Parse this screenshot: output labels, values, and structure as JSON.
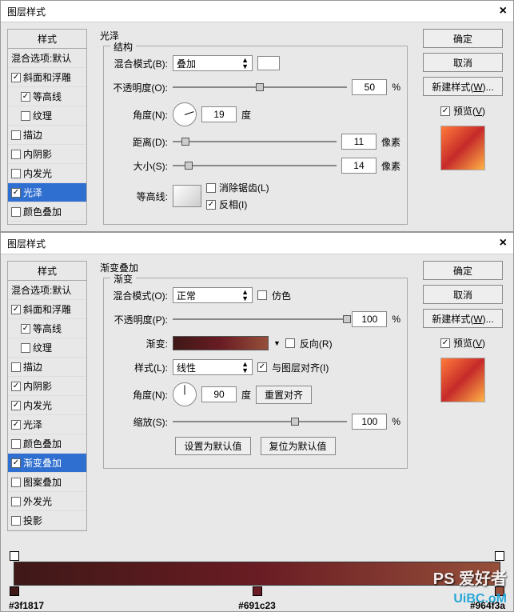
{
  "dialog1": {
    "title": "图层样式",
    "styles_header": "样式",
    "blend_options": "混合选项:默认",
    "items": [
      {
        "label": "斜面和浮雕",
        "checked": true,
        "indent": false
      },
      {
        "label": "等高线",
        "checked": true,
        "indent": true
      },
      {
        "label": "纹理",
        "checked": false,
        "indent": true
      },
      {
        "label": "描边",
        "checked": false,
        "indent": false
      },
      {
        "label": "内阴影",
        "checked": false,
        "indent": false
      },
      {
        "label": "内发光",
        "checked": false,
        "indent": false
      },
      {
        "label": "光泽",
        "checked": true,
        "indent": false,
        "selected": true
      },
      {
        "label": "颜色叠加",
        "checked": false,
        "indent": false
      }
    ],
    "section_title": "光泽",
    "group_title": "结构",
    "rows": {
      "blend_mode_label": "混合模式(B):",
      "blend_mode_value": "叠加",
      "opacity_label": "不透明度(O):",
      "opacity_value": "50",
      "opacity_unit": "%",
      "angle_label": "角度(N):",
      "angle_value": "19",
      "angle_unit": "度",
      "distance_label": "距离(D):",
      "distance_value": "11",
      "distance_unit": "像素",
      "size_label": "大小(S):",
      "size_value": "14",
      "size_unit": "像素",
      "contour_label": "等高线:",
      "antialias_label": "消除锯齿(L)",
      "invert_label": "反相(I)"
    },
    "buttons": {
      "ok": "确定",
      "cancel": "取消",
      "new_style": "新建样式(W)...",
      "preview": "预览(V)"
    }
  },
  "dialog2": {
    "title": "图层样式",
    "styles_header": "样式",
    "blend_options": "混合选项:默认",
    "items": [
      {
        "label": "斜面和浮雕",
        "checked": true,
        "indent": false
      },
      {
        "label": "等高线",
        "checked": true,
        "indent": true
      },
      {
        "label": "纹理",
        "checked": false,
        "indent": true
      },
      {
        "label": "描边",
        "checked": false,
        "indent": false
      },
      {
        "label": "内阴影",
        "checked": true,
        "indent": false
      },
      {
        "label": "内发光",
        "checked": true,
        "indent": false
      },
      {
        "label": "光泽",
        "checked": true,
        "indent": false
      },
      {
        "label": "颜色叠加",
        "checked": false,
        "indent": false
      },
      {
        "label": "渐变叠加",
        "checked": true,
        "indent": false,
        "selected": true
      },
      {
        "label": "图案叠加",
        "checked": false,
        "indent": false
      },
      {
        "label": "外发光",
        "checked": false,
        "indent": false
      },
      {
        "label": "投影",
        "checked": false,
        "indent": false
      }
    ],
    "section_title": "渐变叠加",
    "group_title": "渐变",
    "rows": {
      "blend_mode_label": "混合模式(O):",
      "blend_mode_value": "正常",
      "dither_label": "仿色",
      "opacity_label": "不透明度(P):",
      "opacity_value": "100",
      "opacity_unit": "%",
      "gradient_label": "渐变:",
      "reverse_label": "反向(R)",
      "style_label": "样式(L):",
      "style_value": "线性",
      "align_label": "与图层对齐(I)",
      "angle_label": "角度(N):",
      "angle_value": "90",
      "angle_unit": "度",
      "reset_align": "重置对齐",
      "scale_label": "缩放(S):",
      "scale_value": "100",
      "scale_unit": "%",
      "set_default": "设置为默认值",
      "reset_default": "复位为默认值"
    },
    "buttons": {
      "ok": "确定",
      "cancel": "取消",
      "new_style": "新建样式(W)...",
      "preview": "预览(V)"
    },
    "gradient_stops": {
      "c1": "#3f1817",
      "c2": "#691c23",
      "c3": "#964f3a"
    },
    "watermark1": "PS 爱好者",
    "watermark2": "UiBC.oM"
  }
}
